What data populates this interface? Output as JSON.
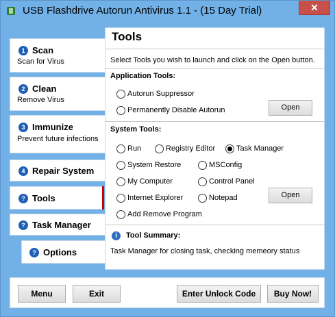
{
  "window": {
    "title": "USB Flashdrive Autorun Antivirus 1.1 - (15 Day Trial)",
    "close_glyph": "✕"
  },
  "sidebar": {
    "items": [
      {
        "num": "1",
        "label": "Scan",
        "sub": "Scan for Virus"
      },
      {
        "num": "2",
        "label": "Clean",
        "sub": "Remove Virus"
      },
      {
        "num": "3",
        "label": "Immunize",
        "sub": "Prevent future infections"
      },
      {
        "num": "4",
        "label": "Repair System"
      },
      {
        "num": "?",
        "label": "Tools"
      },
      {
        "num": "?",
        "label": "Task Manager"
      },
      {
        "num": "?",
        "label": "Options"
      }
    ]
  },
  "tools": {
    "title": "Tools",
    "instruction": "Select Tools you wish to launch and click on the Open button.",
    "app_tools_heading": "Application Tools:",
    "app_tools": [
      "Autorun Suppressor",
      "Permanently Disable Autorun"
    ],
    "open_label": "Open",
    "system_tools_heading": "System Tools:",
    "system_tools": [
      "Run",
      "Registry Editor",
      "Task Manager",
      "System Restore",
      "MSConfig",
      "My Computer",
      "Control Panel",
      "Internet Explorer",
      "Notepad",
      "Add Remove Program"
    ],
    "selected_tool": "Task Manager",
    "summary_heading": "Tool Summary:",
    "summary_text": "Task Manager for closing task, checking memeory status"
  },
  "footer": {
    "menu": "Menu",
    "exit": "Exit",
    "unlock": "Enter Unlock Code",
    "buy": "Buy Now!"
  },
  "colors": {
    "background": "#72b1e7",
    "accent": "#1f5fb5",
    "active": "#d00000"
  }
}
